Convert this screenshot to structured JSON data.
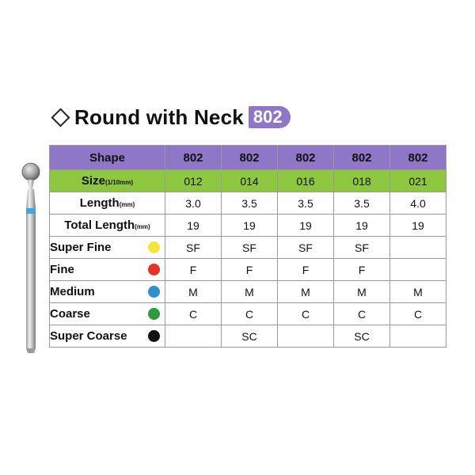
{
  "title": {
    "text": "Round with Neck",
    "code": "802"
  },
  "table": {
    "header": {
      "label": "Shape",
      "values": [
        "802",
        "802",
        "802",
        "802",
        "802"
      ]
    },
    "size": {
      "label": "Size",
      "unit": "(1/10mm)",
      "values": [
        "012",
        "014",
        "016",
        "018",
        "021"
      ]
    },
    "length": {
      "label": "Length",
      "unit": "(mm)",
      "values": [
        "3.0",
        "3.5",
        "3.5",
        "3.5",
        "4.0"
      ]
    },
    "total_length": {
      "label": "Total Length",
      "unit": "(mm)",
      "values": [
        "19",
        "19",
        "19",
        "19",
        "19"
      ]
    },
    "grits": [
      {
        "label": "Super Fine",
        "color": "#f3e53a",
        "values": [
          "SF",
          "SF",
          "SF",
          "SF",
          ""
        ]
      },
      {
        "label": "Fine",
        "color": "#e53326",
        "values": [
          "F",
          "F",
          "F",
          "F",
          ""
        ]
      },
      {
        "label": "Medium",
        "color": "#2f8fcf",
        "values": [
          "M",
          "M",
          "M",
          "M",
          "M"
        ]
      },
      {
        "label": "Coarse",
        "color": "#2d9a3c",
        "values": [
          "C",
          "C",
          "C",
          "C",
          "C"
        ]
      },
      {
        "label": "Super Coarse",
        "color": "#111111",
        "values": [
          "",
          "SC",
          "",
          "SC",
          ""
        ]
      }
    ]
  }
}
